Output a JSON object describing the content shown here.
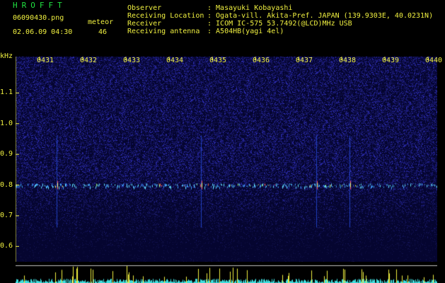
{
  "header": {
    "app_name": "HROFFT",
    "file_name": "06090430.png",
    "datetime": "02.06.09 04:30",
    "meteor_label": "meteor",
    "meteor_count": "46",
    "info_labels": [
      "Observer",
      "Receiving Location",
      "Receiver",
      "Receiving antenna"
    ],
    "info_values": [
      ": Masayuki Kobayashi",
      ": Ogata-vill. Akita-Pref. JAPAN (139.9303E, 40.0231N)",
      ": ICOM IC-575 53.7492(@LCD)MHz USB",
      ": A504HB(yagi 4el)"
    ]
  },
  "chart_data": {
    "type": "heatmap",
    "ylabel": "kHz",
    "x_ticks": [
      "0431",
      "0432",
      "0433",
      "0434",
      "0435",
      "0436",
      "0437",
      "0438",
      "0439",
      "0440"
    ],
    "y_ticks": [
      "1.1",
      "1.0",
      "0.9",
      "0.8",
      "0.7",
      "0.6"
    ],
    "y_tick_values": [
      1.1,
      1.0,
      0.9,
      0.8,
      0.7,
      0.6
    ],
    "ylim": [
      0.55,
      1.2
    ],
    "echo_band_khz": 0.8,
    "meter_line_khz": [
      0.6
    ]
  },
  "colors": {
    "background": "#000000",
    "noise": "#0a0a50",
    "accent_yellow": "#f0f040",
    "accent_green": "#20e040"
  }
}
